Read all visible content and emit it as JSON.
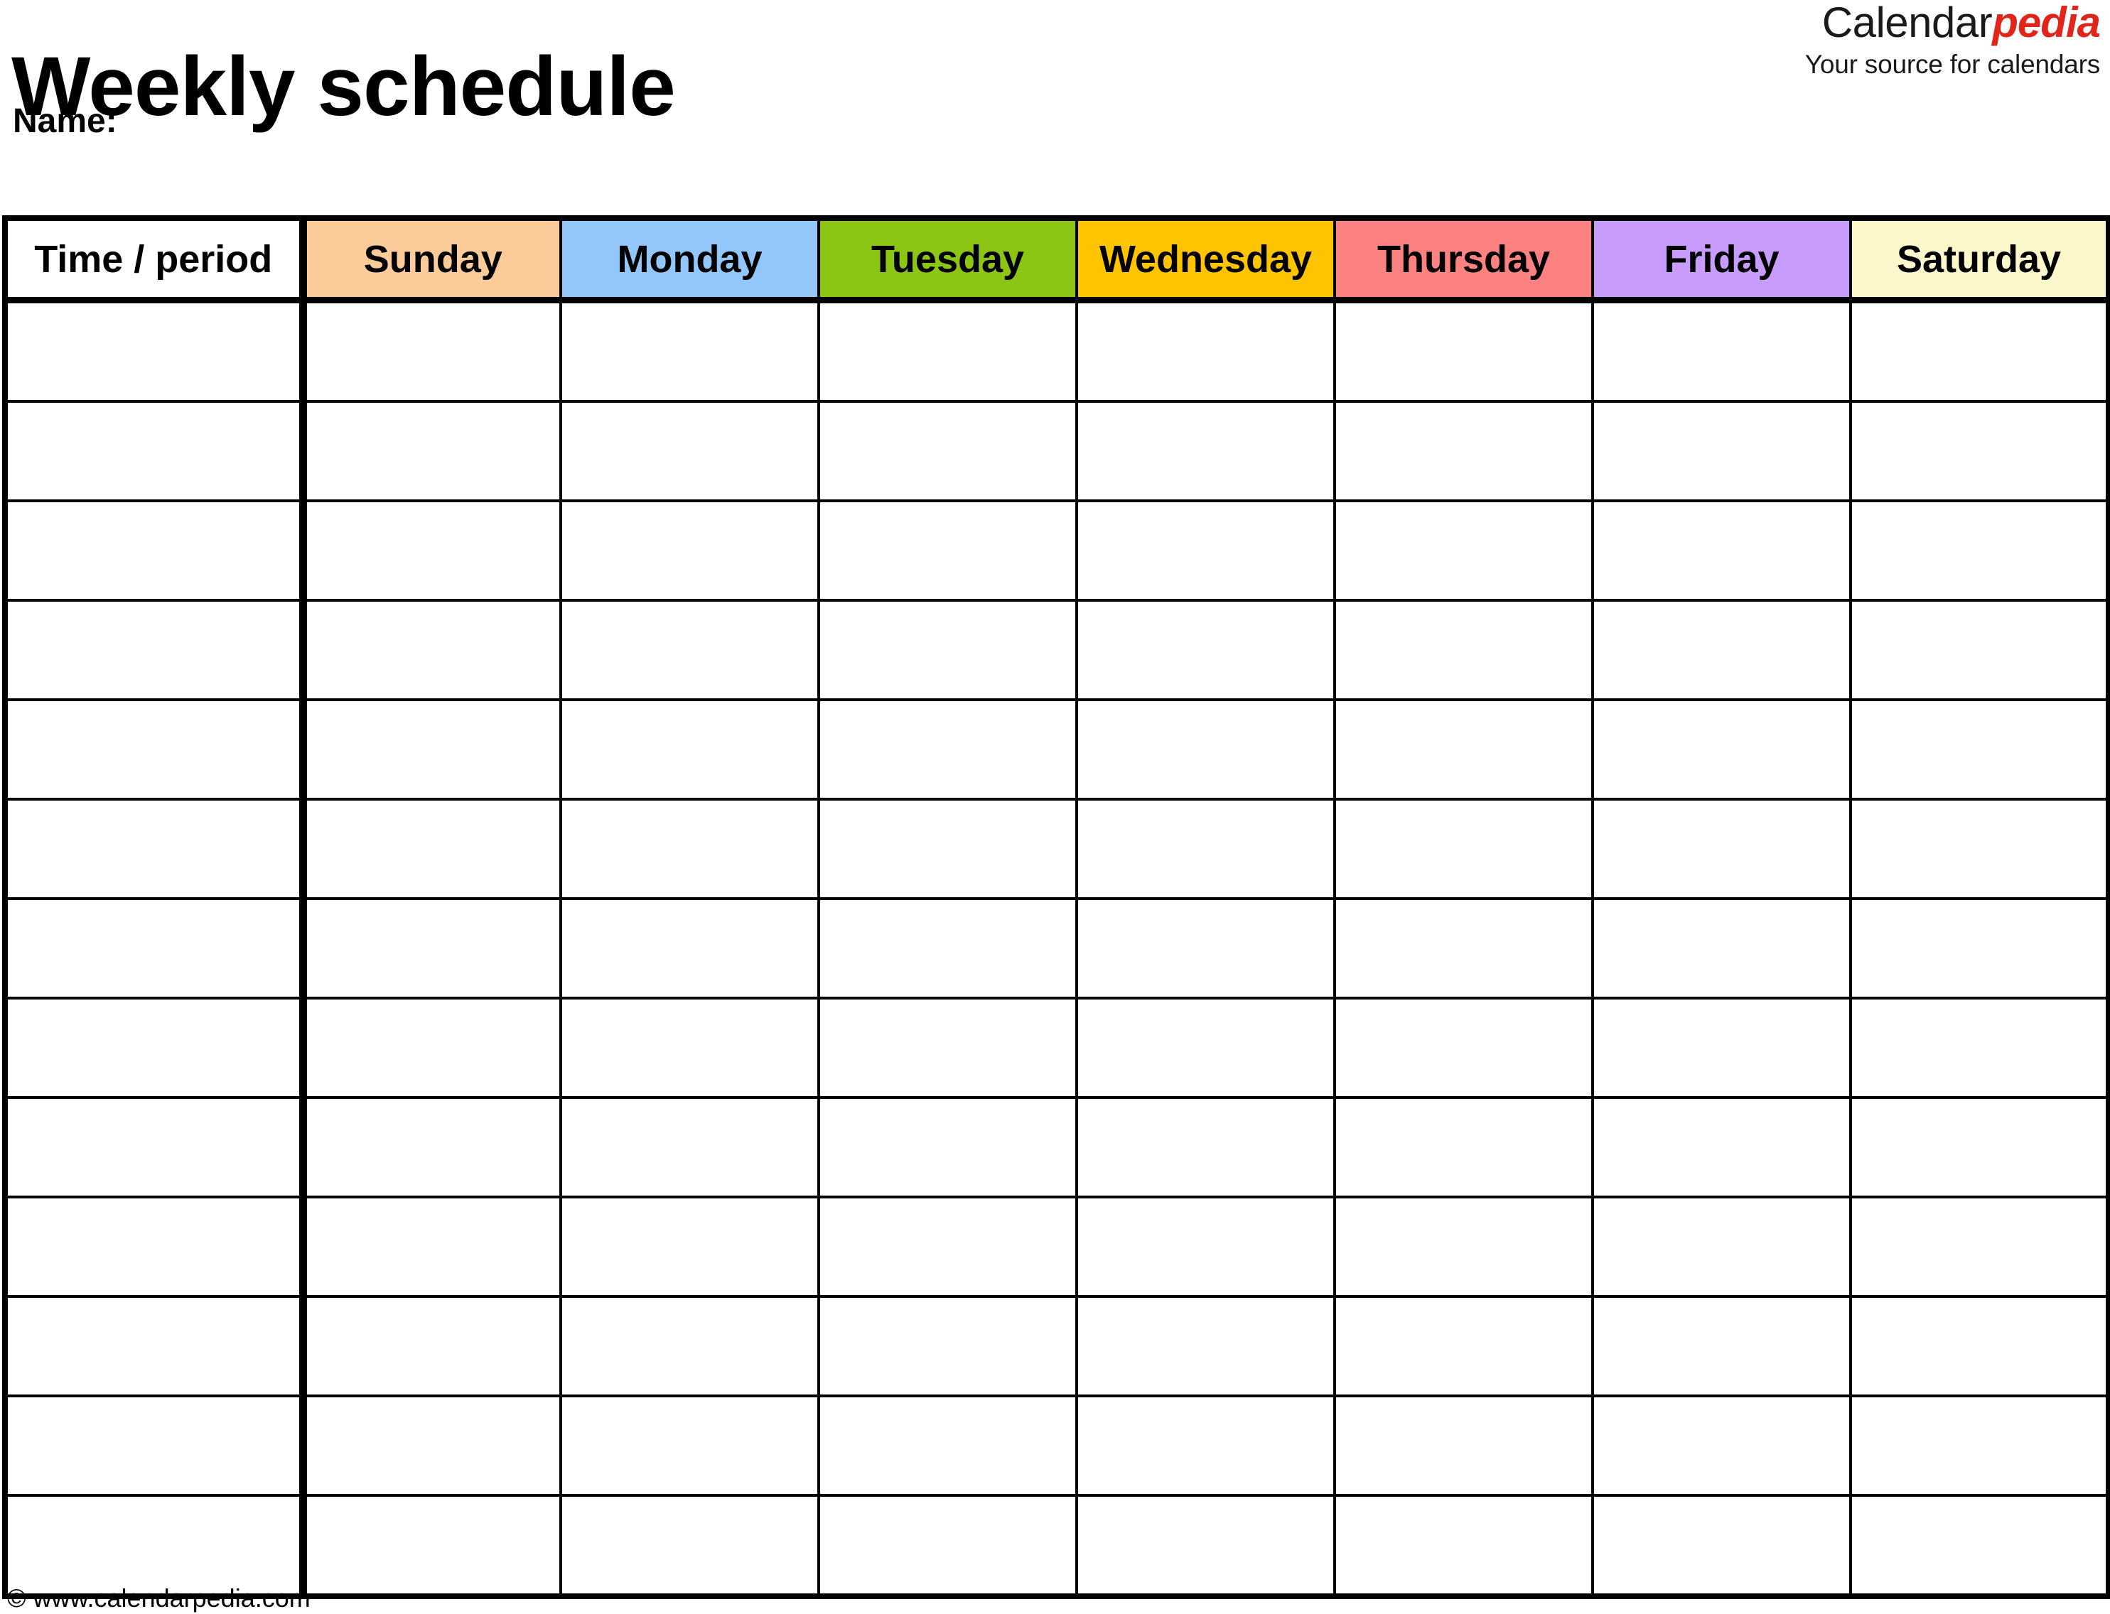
{
  "document": {
    "title": "Weekly schedule",
    "name_label": "Name:"
  },
  "brand": {
    "name_part1": "Calendar",
    "name_part2": "pedia",
    "tagline": "Your source for calendars",
    "accent_color": "#e1251b",
    "text_color": "#1a1a1a"
  },
  "table": {
    "time_column_header": "Time / period",
    "day_headers": [
      {
        "label": "Sunday",
        "color": "#fbcb9a"
      },
      {
        "label": "Monday",
        "color": "#93c6f9"
      },
      {
        "label": "Tuesday",
        "color": "#8cc513"
      },
      {
        "label": "Wednesday",
        "color": "#ffc400"
      },
      {
        "label": "Thursday",
        "color": "#fc8181"
      },
      {
        "label": "Friday",
        "color": "#c79cfc"
      },
      {
        "label": "Saturday",
        "color": "#fcf8cc"
      }
    ],
    "row_count": 13,
    "rows": [
      {
        "time": "",
        "cells": [
          "",
          "",
          "",
          "",
          "",
          "",
          ""
        ]
      },
      {
        "time": "",
        "cells": [
          "",
          "",
          "",
          "",
          "",
          "",
          ""
        ]
      },
      {
        "time": "",
        "cells": [
          "",
          "",
          "",
          "",
          "",
          "",
          ""
        ]
      },
      {
        "time": "",
        "cells": [
          "",
          "",
          "",
          "",
          "",
          "",
          ""
        ]
      },
      {
        "time": "",
        "cells": [
          "",
          "",
          "",
          "",
          "",
          "",
          ""
        ]
      },
      {
        "time": "",
        "cells": [
          "",
          "",
          "",
          "",
          "",
          "",
          ""
        ]
      },
      {
        "time": "",
        "cells": [
          "",
          "",
          "",
          "",
          "",
          "",
          ""
        ]
      },
      {
        "time": "",
        "cells": [
          "",
          "",
          "",
          "",
          "",
          "",
          ""
        ]
      },
      {
        "time": "",
        "cells": [
          "",
          "",
          "",
          "",
          "",
          "",
          ""
        ]
      },
      {
        "time": "",
        "cells": [
          "",
          "",
          "",
          "",
          "",
          "",
          ""
        ]
      },
      {
        "time": "",
        "cells": [
          "",
          "",
          "",
          "",
          "",
          "",
          ""
        ]
      },
      {
        "time": "",
        "cells": [
          "",
          "",
          "",
          "",
          "",
          "",
          ""
        ]
      },
      {
        "time": "",
        "cells": [
          "",
          "",
          "",
          "",
          "",
          "",
          ""
        ]
      }
    ]
  },
  "footer": {
    "copyright": "© www.calendarpedia.com"
  }
}
